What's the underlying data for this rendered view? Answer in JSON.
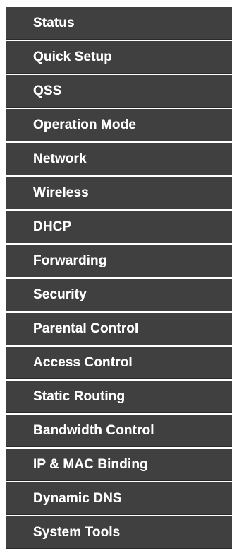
{
  "menu": {
    "items": [
      {
        "label": "Status"
      },
      {
        "label": "Quick Setup"
      },
      {
        "label": "QSS"
      },
      {
        "label": "Operation Mode"
      },
      {
        "label": "Network"
      },
      {
        "label": "Wireless"
      },
      {
        "label": "DHCP"
      },
      {
        "label": "Forwarding"
      },
      {
        "label": "Security"
      },
      {
        "label": "Parental Control"
      },
      {
        "label": "Access Control"
      },
      {
        "label": "Static Routing"
      },
      {
        "label": "Bandwidth Control"
      },
      {
        "label": "IP & MAC Binding"
      },
      {
        "label": "Dynamic DNS"
      },
      {
        "label": "System Tools"
      }
    ]
  },
  "colors": {
    "item_background": "#404040",
    "item_text": "#ffffff",
    "page_background": "#ffffff"
  }
}
